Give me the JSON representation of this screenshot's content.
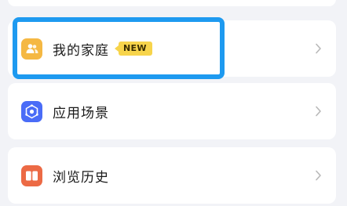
{
  "menu": {
    "items": [
      {
        "label": "我的家庭",
        "icon": "family-icon",
        "badge": "NEW"
      },
      {
        "label": "应用场景",
        "icon": "scene-icon"
      },
      {
        "label": "浏览历史",
        "icon": "book-icon"
      }
    ]
  },
  "colors": {
    "background": "#f2f3f7",
    "family_icon": "#f5b843",
    "scene_icon": "#4a6cf7",
    "history_icon": "#ec6a45",
    "badge": "#f7d44b",
    "highlight": "#1e9af0"
  }
}
